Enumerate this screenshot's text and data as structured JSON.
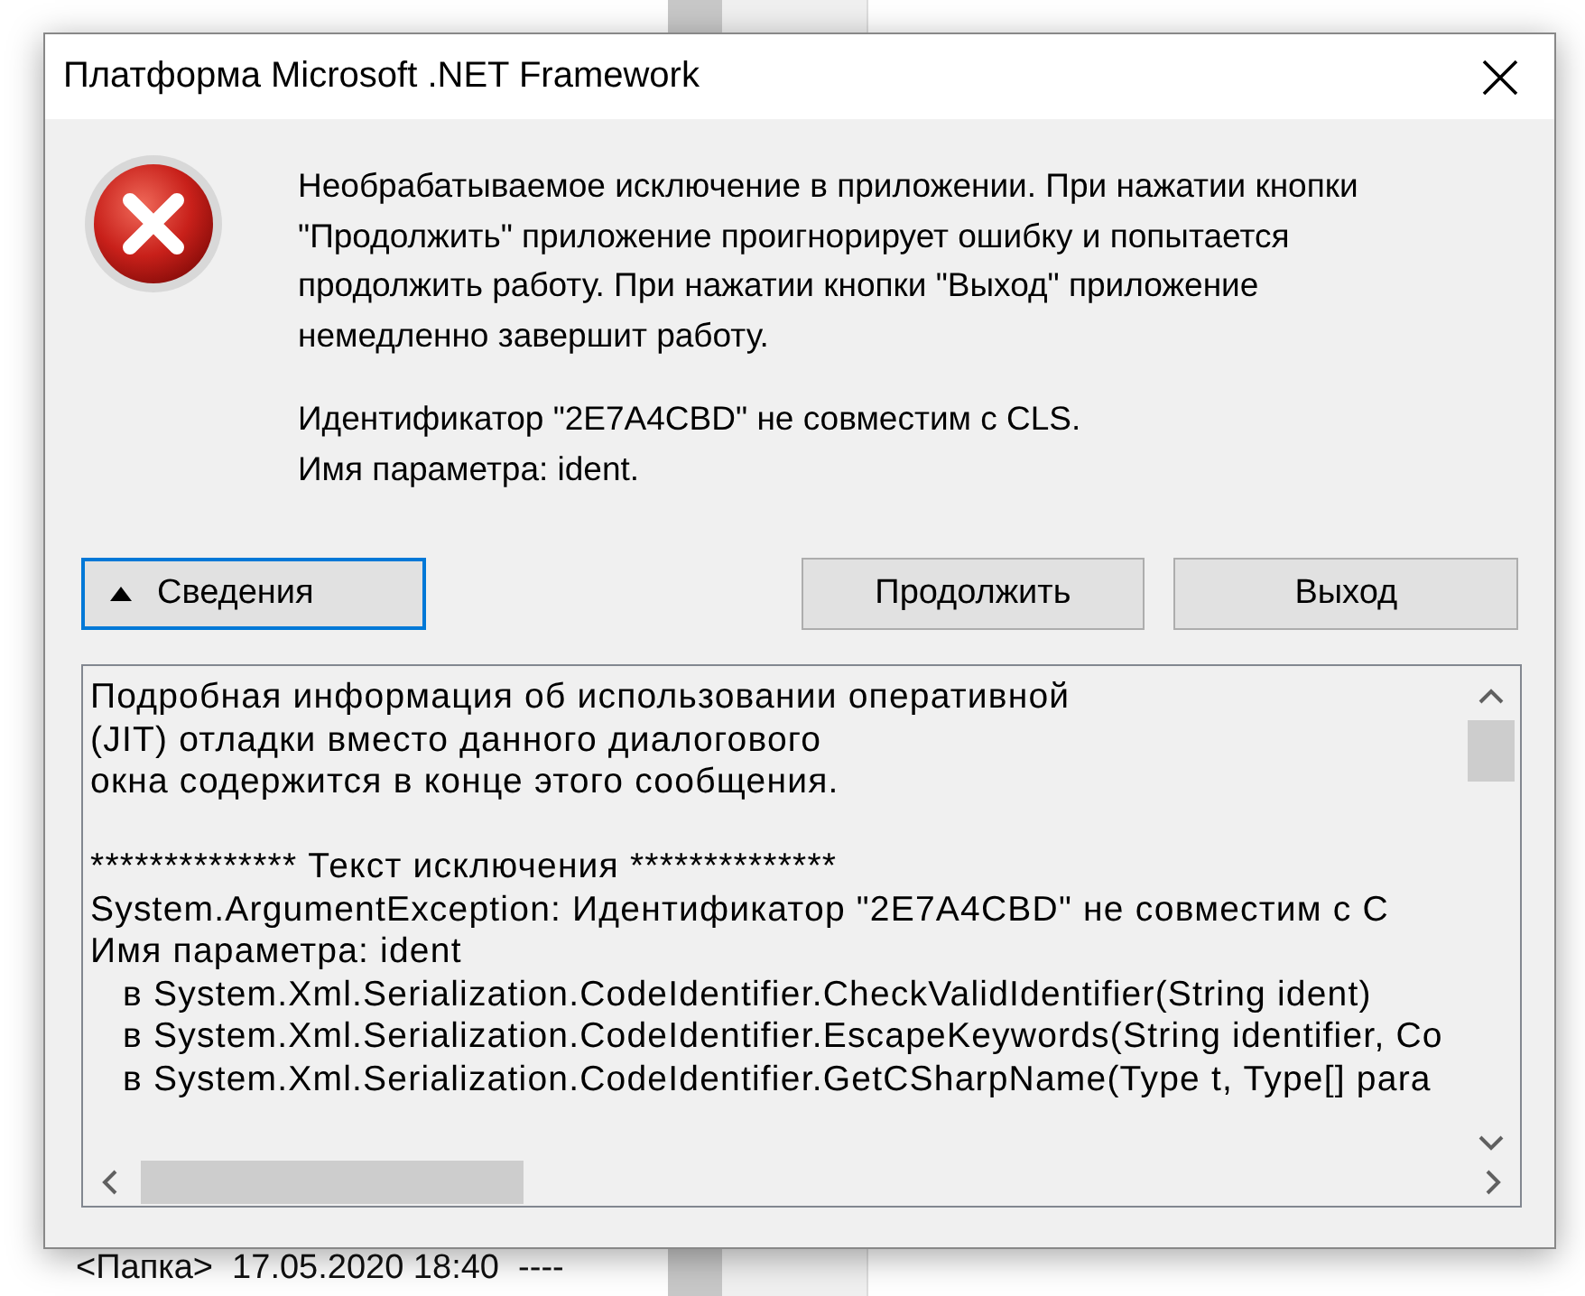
{
  "window": {
    "title": "Платформа Microsoft .NET Framework"
  },
  "message": {
    "paragraphs": [
      "Необрабатываемое исключение в приложении. При нажатии кнопки \"Продолжить\" приложение проигнорирует ошибку и попытается продолжить работу. При нажатии кнопки \"Выход\" приложение немедленно завершит работу.",
      "Идентификатор \"2E7A4CBD\" не совместим с CLS.\nИмя параметра: ident."
    ]
  },
  "buttons": [
    {
      "kind": "details",
      "label": "Сведения",
      "expanded": true
    },
    {
      "kind": "plain",
      "label": "Продолжить"
    },
    {
      "kind": "plain",
      "label": "Выход"
    }
  ],
  "details_blocks": [
    {
      "lines": [
        "Подробная информация об использовании оперативной",
        "(JIT) отладки вместо данного диалогового",
        "окна содержится в конце этого сообщения."
      ]
    },
    {
      "lines": [
        "************** Текст исключения **************",
        "System.ArgumentException: Идентификатор \"2E7A4CBD\" не совместим с C",
        "Имя параметра: ident",
        "   в System.Xml.Serialization.CodeIdentifier.CheckValidIdentifier(String ident)",
        "   в System.Xml.Serialization.CodeIdentifier.EscapeKeywords(String identifier, Co",
        "   в System.Xml.Serialization.CodeIdentifier.GetCSharpName(Type t, Type[] para"
      ]
    }
  ],
  "background": {
    "row_text": "<Папка>  17.05.2020 18:40  ----"
  }
}
